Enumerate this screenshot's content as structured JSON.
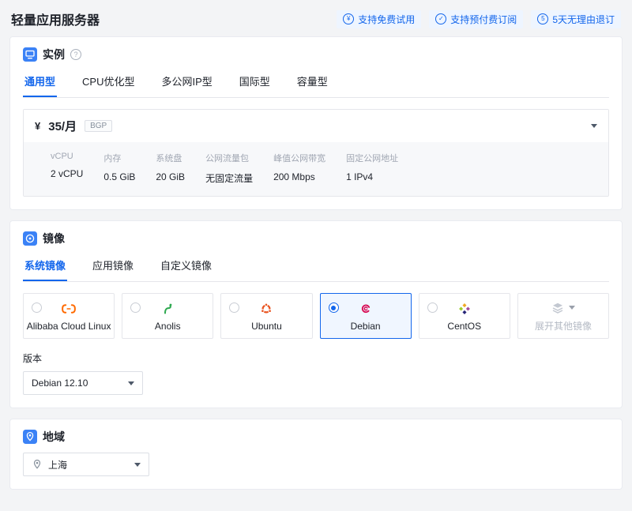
{
  "page": {
    "title": "轻量应用服务器",
    "badges": [
      {
        "label": "支持免费试用",
        "icon_glyph": "¥"
      },
      {
        "label": "支持预付费订阅",
        "icon_glyph": "✓"
      },
      {
        "label": "5天无理由退订",
        "icon_glyph": "5"
      }
    ]
  },
  "icons": {
    "help": "?"
  },
  "colors": {
    "accent_blue": "#1366ec",
    "selected_bg": "#f0f6ff",
    "alibaba_orange": "#FF6A00",
    "anolis_green": "#2ca84e",
    "ubuntu_orange": "#E95420",
    "debian_red": "#d70a53"
  },
  "instance": {
    "section_title": "实例",
    "tabs": [
      {
        "label": "通用型",
        "active": true
      },
      {
        "label": "CPU优化型",
        "active": false
      },
      {
        "label": "多公网IP型",
        "active": false
      },
      {
        "label": "国际型",
        "active": false
      },
      {
        "label": "容量型",
        "active": false
      }
    ],
    "plan": {
      "price_currency": "¥",
      "price_amount": "35/月",
      "network_tag": "BGP",
      "specs": [
        {
          "label": "vCPU",
          "value": "2 vCPU"
        },
        {
          "label": "内存",
          "value": "0.5 GiB"
        },
        {
          "label": "系统盘",
          "value": "20 GiB"
        },
        {
          "label": "公网流量包",
          "value": "无固定流量"
        },
        {
          "label": "峰值公网带宽",
          "value": "200 Mbps"
        },
        {
          "label": "固定公网地址",
          "value": "1 IPv4"
        }
      ]
    }
  },
  "image": {
    "section_title": "镜像",
    "tabs": [
      {
        "label": "系统镜像",
        "active": true
      },
      {
        "label": "应用镜像",
        "active": false
      },
      {
        "label": "自定义镜像",
        "active": false
      }
    ],
    "os_options": [
      {
        "label": "Alibaba Cloud Linux",
        "selected": false
      },
      {
        "label": "Anolis",
        "selected": false
      },
      {
        "label": "Ubuntu",
        "selected": false
      },
      {
        "label": "Debian",
        "selected": true
      },
      {
        "label": "CentOS",
        "selected": false
      }
    ],
    "expand_label": "展开其他镜像",
    "version_label": "版本",
    "version_value": "Debian 12.10"
  },
  "region": {
    "section_title": "地域",
    "value": "上海"
  }
}
